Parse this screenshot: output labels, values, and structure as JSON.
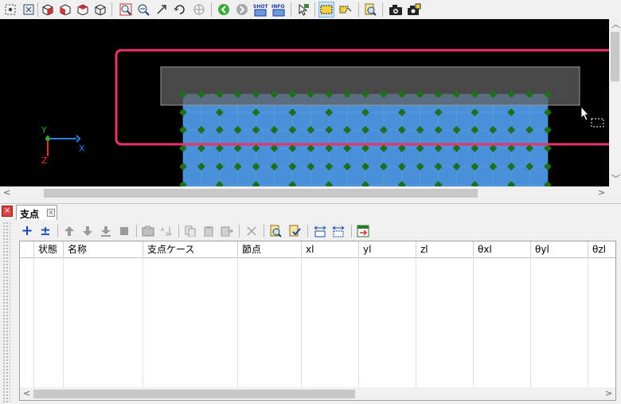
{
  "toolbar": {
    "buttons": [
      {
        "icon": "node-select-icon"
      },
      {
        "icon": "fit-view-icon"
      },
      {
        "icon": "view-3d-icon"
      },
      {
        "icon": "view-front-icon"
      },
      {
        "icon": "view-side-icon"
      },
      {
        "icon": "view-wire-icon"
      },
      {
        "icon": "zoom-window-icon"
      },
      {
        "icon": "zoom-out-icon"
      },
      {
        "icon": "zoom-arrow-icon"
      },
      {
        "icon": "rotate-icon"
      },
      {
        "icon": "pan-icon"
      },
      {
        "icon": "back-icon"
      },
      {
        "icon": "forward-icon"
      },
      {
        "icon": "shot-icon",
        "label": "SHOT"
      },
      {
        "icon": "info-icon",
        "label": "INFO"
      },
      {
        "icon": "pointer-select-icon"
      },
      {
        "icon": "rect-select-icon"
      },
      {
        "icon": "lasso-select-icon"
      },
      {
        "icon": "find-icon"
      },
      {
        "icon": "camera-icon"
      },
      {
        "icon": "camera-save-icon"
      }
    ],
    "colors": {
      "select_highlight": "#cce4f7",
      "back_green": "#3aaa35"
    }
  },
  "viewport": {
    "background": "#000000",
    "axes": {
      "y_label": "Y",
      "x_label": "X",
      "z_label": "Z"
    },
    "colors": {
      "mesh": "#4a90d9",
      "nodes": "#1e6e1e",
      "selection_box": "#e8336b",
      "plate": "#4a4a4a"
    }
  },
  "panel": {
    "tab_label": "支点",
    "close_x": "×"
  },
  "panel_toolbar": {
    "buttons": [
      {
        "icon": "add-icon",
        "label": "+"
      },
      {
        "icon": "add-multiple-icon",
        "label": "±"
      },
      {
        "icon": "move-up-icon"
      },
      {
        "icon": "move-down-icon"
      },
      {
        "icon": "move-bottom-icon"
      },
      {
        "icon": "move-end-icon"
      },
      {
        "icon": "import-icon"
      },
      {
        "icon": "sort-icon"
      },
      {
        "icon": "copy-icon"
      },
      {
        "icon": "paste-icon"
      },
      {
        "icon": "paste-special-icon"
      },
      {
        "icon": "delete-icon"
      },
      {
        "icon": "find-icon"
      },
      {
        "icon": "check-icon"
      },
      {
        "icon": "fit-columns-icon"
      },
      {
        "icon": "auto-width-icon"
      },
      {
        "icon": "export-icon"
      }
    ]
  },
  "grid": {
    "columns": [
      "",
      "状態",
      "名称",
      "支点ケース",
      "節点",
      "xl",
      "yl",
      "zl",
      "θxl",
      "θyl",
      "θzl"
    ],
    "rows": []
  }
}
